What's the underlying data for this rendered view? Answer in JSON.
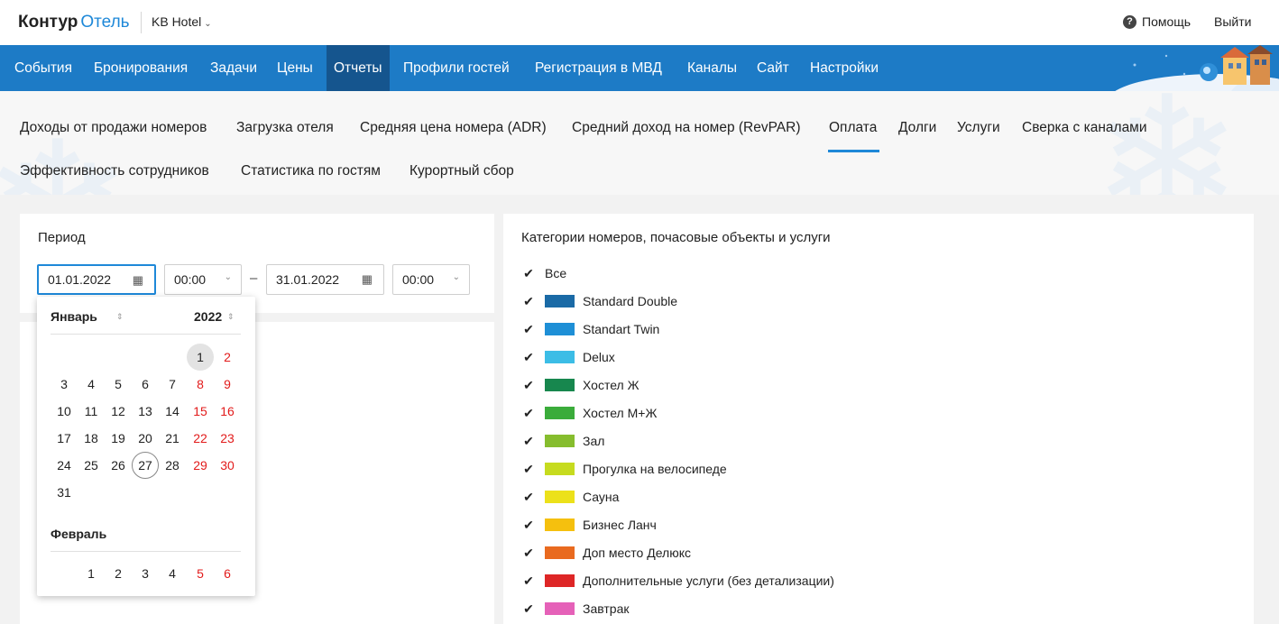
{
  "app": {
    "logo_primary": "Контур",
    "logo_secondary": "Отель",
    "hotel_name": "KB Hotel"
  },
  "header": {
    "help_label": "Помощь",
    "logout_label": "Выйти"
  },
  "main_nav": [
    {
      "label": "События"
    },
    {
      "label": "Бронирования"
    },
    {
      "label": "Задачи"
    },
    {
      "label": "Цены"
    },
    {
      "label": "Отчеты",
      "active": true
    },
    {
      "label": "Профили гостей"
    },
    {
      "label": "Регистрация в МВД"
    },
    {
      "label": "Каналы"
    },
    {
      "label": "Сайт"
    },
    {
      "label": "Настройки"
    }
  ],
  "sub_nav": [
    {
      "label": "Доходы от продажи номеров"
    },
    {
      "label": "Загрузка отеля"
    },
    {
      "label": "Средняя цена номера (ADR)"
    },
    {
      "label": "Средний доход на номер (RevPAR)"
    },
    {
      "label": "Оплата",
      "active": true
    },
    {
      "label": "Долги"
    },
    {
      "label": "Услуги"
    },
    {
      "label": "Сверка с каналами"
    },
    {
      "label": "Эффективность сотрудников"
    },
    {
      "label": "Статистика по гостям"
    },
    {
      "label": "Курортный сбор"
    }
  ],
  "period": {
    "label": "Период",
    "date_from": "01.01.2022",
    "time_from": "00:00",
    "separator": "–",
    "date_to": "31.01.2022",
    "time_to": "00:00"
  },
  "calendar": {
    "month": "Январь",
    "year": "2022",
    "january_days": [
      "1",
      "2",
      "3",
      "4",
      "5",
      "6",
      "7",
      "8",
      "9",
      "10",
      "11",
      "12",
      "13",
      "14",
      "15",
      "16",
      "17",
      "18",
      "19",
      "20",
      "21",
      "22",
      "23",
      "24",
      "25",
      "26",
      "27",
      "28",
      "29",
      "30",
      "31"
    ],
    "next_month": "Февраль",
    "february_days": [
      "1",
      "2",
      "3",
      "4",
      "5",
      "6"
    ],
    "selected_day": "1",
    "today": "27"
  },
  "categories": {
    "title": "Категории номеров, почасовые объекты и услуги",
    "items": [
      {
        "label": "Все",
        "checked": true,
        "color": ""
      },
      {
        "label": "Standard Double",
        "checked": true,
        "color": "#1a6aa6"
      },
      {
        "label": "Standart Twin",
        "checked": true,
        "color": "#1e8fd6"
      },
      {
        "label": "Delux",
        "checked": true,
        "color": "#3cbde6"
      },
      {
        "label": "Хостел Ж",
        "checked": true,
        "color": "#17874e"
      },
      {
        "label": "Хостел М+Ж",
        "checked": true,
        "color": "#3bac3b"
      },
      {
        "label": "Зал",
        "checked": true,
        "color": "#86bd2e"
      },
      {
        "label": "Прогулка на велосипеде",
        "checked": true,
        "color": "#c6db1f"
      },
      {
        "label": "Сауна",
        "checked": true,
        "color": "#ece11a"
      },
      {
        "label": "Бизнес Ланч",
        "checked": true,
        "color": "#f5c00e"
      },
      {
        "label": "Доп место Делюкс",
        "checked": true,
        "color": "#e96a1f"
      },
      {
        "label": "Дополнительные услуги (без детализации)",
        "checked": true,
        "color": "#de2626"
      },
      {
        "label": "Завтрак",
        "checked": true,
        "color": "#e561b8"
      }
    ]
  }
}
